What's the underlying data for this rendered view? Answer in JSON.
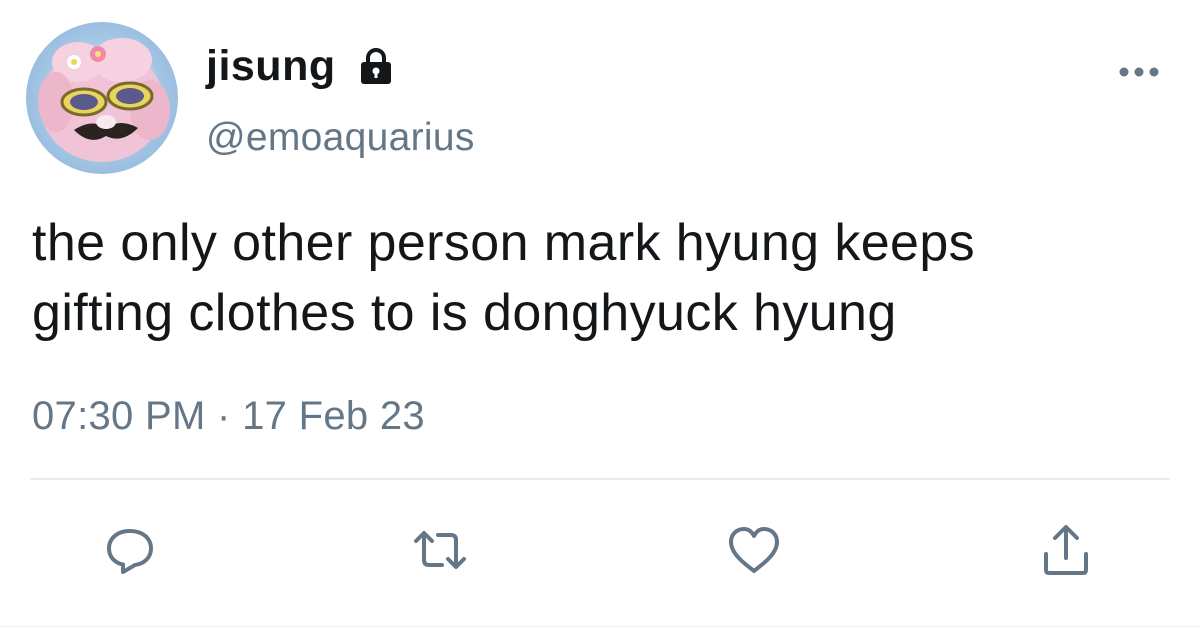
{
  "tweet": {
    "author": {
      "display_name": "jisung",
      "handle": "@emoaquarius",
      "protected_icon": "lock-icon",
      "avatar_icon": "avatar-image"
    },
    "text_lines": [
      "the only other person mark hyung keeps",
      "gifting clothes to is donghyuck hyung"
    ],
    "time": "07:30 PM",
    "separator": "·",
    "date": "17 Feb 23",
    "more_icon": "more-icon",
    "actions": [
      {
        "name": "reply",
        "icon": "reply-icon"
      },
      {
        "name": "retweet",
        "icon": "retweet-icon"
      },
      {
        "name": "like",
        "icon": "heart-icon"
      },
      {
        "name": "share",
        "icon": "share-icon"
      }
    ]
  },
  "colors": {
    "text_primary": "#14171a",
    "text_secondary": "#657786",
    "icon": "#657786",
    "divider": "#e6ecf0"
  }
}
